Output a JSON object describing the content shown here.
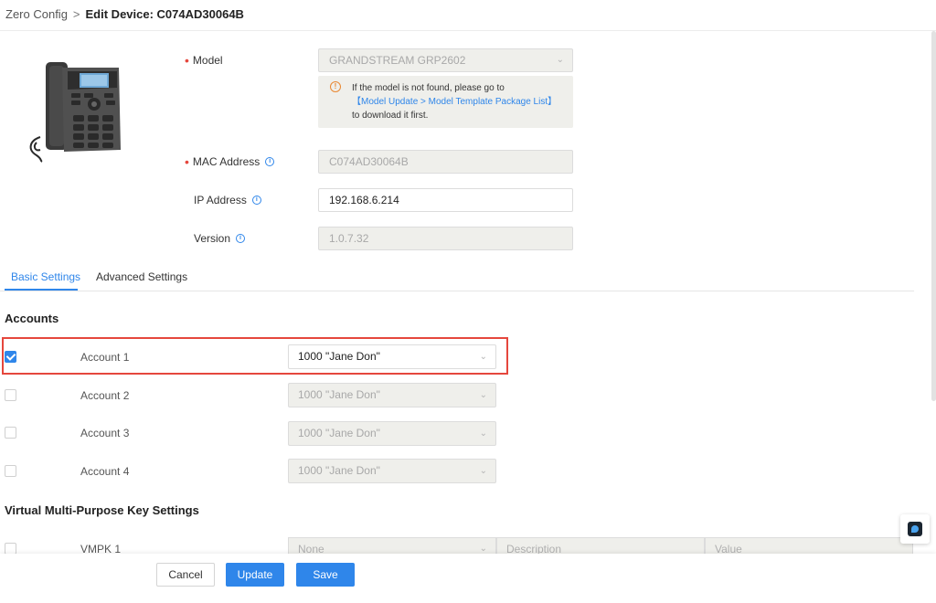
{
  "breadcrumb": {
    "parent": "Zero Config",
    "separator": ">",
    "current": "Edit Device: C074AD30064B"
  },
  "device": {
    "model_label": "Model",
    "model_value": "GRANDSTREAM GRP2602",
    "hint_line1": "If the model is not found, please go to",
    "hint_link": "【Model Update > Model Template Package List】",
    "hint_line3": "to download it first.",
    "mac_label": "MAC Address",
    "mac_value": "C074AD30064B",
    "ip_label": "IP Address",
    "ip_value": "192.168.6.214",
    "version_label": "Version",
    "version_value": "1.0.7.32"
  },
  "tabs": {
    "basic": "Basic Settings",
    "advanced": "Advanced Settings"
  },
  "accounts": {
    "title": "Accounts",
    "rows": [
      {
        "label": "Account 1",
        "value": "1000 \"Jane Don\"",
        "checked": true
      },
      {
        "label": "Account 2",
        "value": "1000 \"Jane Don\"",
        "checked": false
      },
      {
        "label": "Account 3",
        "value": "1000 \"Jane Don\"",
        "checked": false
      },
      {
        "label": "Account 4",
        "value": "1000 \"Jane Don\"",
        "checked": false
      }
    ]
  },
  "vmpk": {
    "title": "Virtual Multi-Purpose Key Settings",
    "row_label": "VMPK 1",
    "type_value": "None",
    "description_placeholder": "Description",
    "value_placeholder": "Value"
  },
  "footer": {
    "cancel": "Cancel",
    "update": "Update",
    "save": "Save"
  },
  "colors": {
    "accent": "#2f86ea",
    "required": "#e5473d",
    "highlight": "#e5473d",
    "warning": "#e98832"
  }
}
